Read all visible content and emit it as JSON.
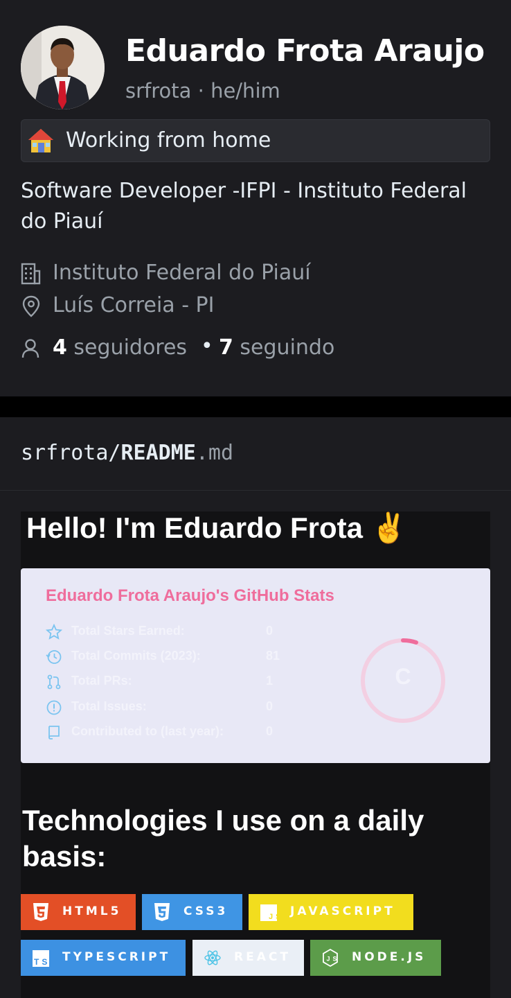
{
  "profile": {
    "name": "Eduardo Frota Araujo",
    "handle": "srfrota · he/him",
    "status": "Working from home",
    "status_emoji": "house-emoji",
    "bio": "Software Developer -IFPI - Instituto Federal do Piauí",
    "organization": "Instituto Federal do Piauí",
    "location": "Luís Correia - PI",
    "followers_count": "4",
    "followers_label": "seguidores",
    "separator": "•",
    "following_count": "7",
    "following_label": "seguindo"
  },
  "readme": {
    "owner": "srfrota/",
    "file": "README",
    "ext": ".md",
    "heading": "Hello! I'm Eduardo Frota ✌️",
    "stats_card": {
      "title": "Eduardo Frota Araujo's GitHub Stats",
      "rows": [
        {
          "label": "Total Stars Earned:",
          "value": "0",
          "icon": "star-icon"
        },
        {
          "label": "Total Commits (2023):",
          "value": "81",
          "icon": "history-icon"
        },
        {
          "label": "Total PRs:",
          "value": "1",
          "icon": "pull-request-icon"
        },
        {
          "label": "Total Issues:",
          "value": "0",
          "icon": "issue-icon"
        },
        {
          "label": "Contributed to (last year):",
          "value": "0",
          "icon": "repo-icon"
        }
      ],
      "rank": "C",
      "colors": {
        "title": "#ef6d9c",
        "ring": "#ef6d9c",
        "bg": "#e8e8f6"
      }
    },
    "tech_heading": "Technologies I use on a daily basis:",
    "badges": [
      {
        "label": "HTML5",
        "bg": "#e34f26",
        "fg": "#ffffff",
        "icon": "html5-icon"
      },
      {
        "label": "CSS3",
        "bg": "#3f95e4",
        "fg": "#ffffff",
        "icon": "css3-icon"
      },
      {
        "label": "JAVASCRIPT",
        "bg": "#f2dd1e",
        "fg": "#ffffff",
        "icon": "javascript-icon"
      },
      {
        "label": "TYPESCRIPT",
        "bg": "#3d91e2",
        "fg": "#ffffff",
        "icon": "typescript-icon"
      },
      {
        "label": "REACT",
        "bg": "#eaeff6",
        "fg": "#ffffff",
        "icon": "react-icon"
      },
      {
        "label": "NODE.JS",
        "bg": "#5c9c4a",
        "fg": "#ffffff",
        "icon": "nodejs-icon"
      }
    ]
  }
}
